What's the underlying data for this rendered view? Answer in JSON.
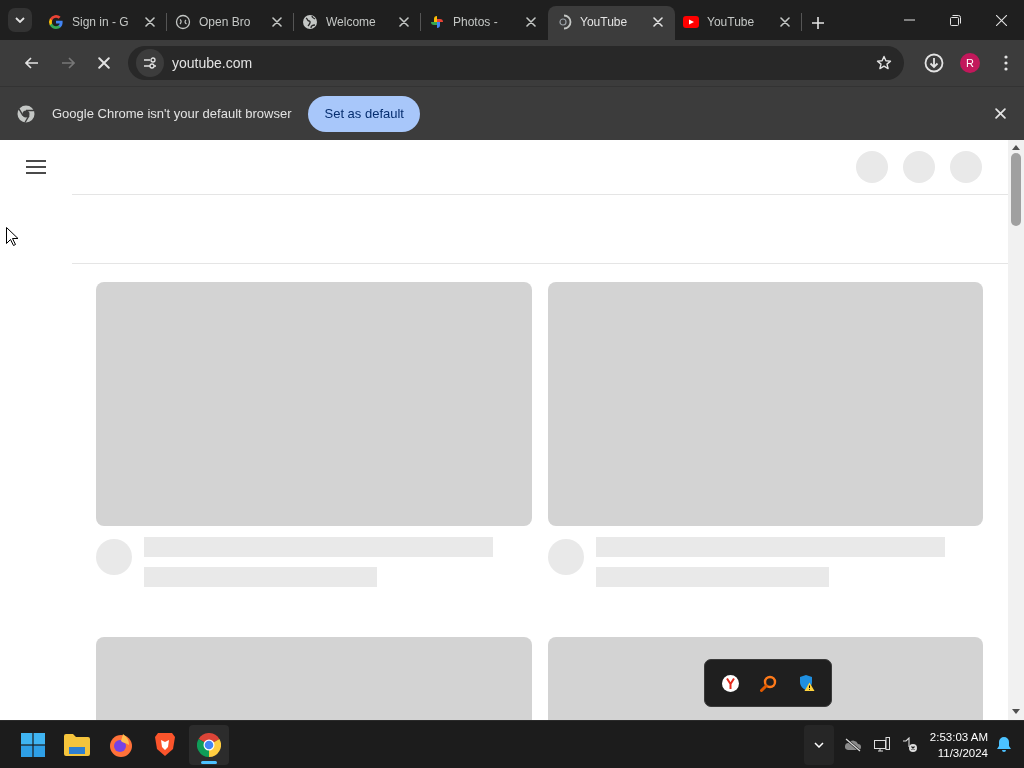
{
  "tabs": [
    {
      "title": "Sign in - G",
      "selected": false
    },
    {
      "title": "Open Bro",
      "selected": false
    },
    {
      "title": "Welcome",
      "selected": false
    },
    {
      "title": "Photos -",
      "selected": false
    },
    {
      "title": "YouTube",
      "selected": true
    },
    {
      "title": "YouTube",
      "selected": false
    }
  ],
  "toolbar": {
    "loading": true,
    "url": "youtube.com",
    "bookmarked": false,
    "avatar": "R"
  },
  "infobar": {
    "message": "Google Chrome isn't your default browser",
    "button": "Set as default"
  },
  "taskbar": {
    "apps": [
      {
        "selected": false
      },
      {
        "selected": false
      },
      {
        "selected": false
      },
      {
        "selected": false
      },
      {
        "selected": true
      }
    ],
    "time": "2:53:03 AM",
    "date": "11/3/2024"
  }
}
